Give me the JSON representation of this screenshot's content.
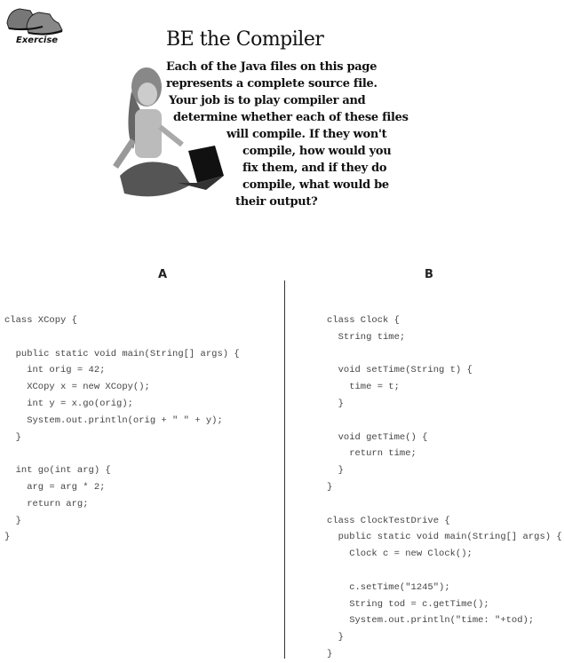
{
  "header": {
    "exercise_label": "Exercise",
    "title": "BE the Compiler",
    "intro_lines": [
      "Each of the Java files on this page",
      "represents a complete source file.",
      "Your job is to play compiler and",
      "determine whether each of these files",
      "will compile.  If they won't",
      "compile, how would you",
      "fix them, and if they do",
      "compile, what would be",
      "their output?"
    ]
  },
  "columns": [
    {
      "label": "A",
      "code": [
        "class XCopy {",
        "",
        "  public static void main(String[] args) {",
        "    int orig = 42;",
        "    XCopy x = new XCopy();",
        "    int y = x.go(orig);",
        "    System.out.println(orig + \" \" + y);",
        "  }",
        "",
        "  int go(int arg) {",
        "    arg = arg * 2;",
        "    return arg;",
        "  }",
        "}"
      ]
    },
    {
      "label": "B",
      "code": [
        "class Clock {",
        "  String time;",
        "",
        "  void setTime(String t) {",
        "    time = t;",
        "  }",
        "",
        "  void getTime() {",
        "    return time;",
        "  }",
        "}",
        "",
        "class ClockTestDrive {",
        "  public static void main(String[] args) {",
        "    Clock c = new Clock();",
        "",
        "    c.setTime(\"1245\");",
        "    String tod = c.getTime();",
        "    System.out.println(\"time: \"+tod);",
        "  }",
        "}"
      ]
    }
  ]
}
